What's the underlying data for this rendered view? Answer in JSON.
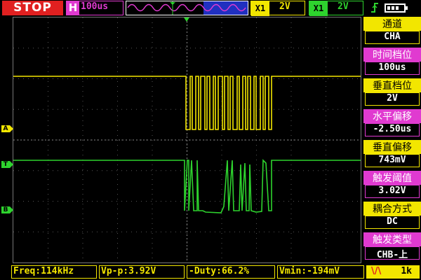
{
  "status": {
    "run_state": "STOP"
  },
  "timebase": {
    "label": "H",
    "value": "100us"
  },
  "channel_a": {
    "label": "X1",
    "volts_per_div": "2V",
    "color": "#f2e600"
  },
  "channel_b": {
    "label": "X1",
    "volts_per_div": "2V",
    "color": "#2ed32e"
  },
  "trigger_edge_icon": "rising-edge-icon",
  "battery": {
    "level": 0.75
  },
  "markers": {
    "ch_a": "A",
    "trigger": "T",
    "ch_b": "B"
  },
  "side_panel": [
    {
      "label": "通道",
      "value": "CHA",
      "color": "#f2e600"
    },
    {
      "label": "时间档位",
      "value": "100us",
      "color": "#e03ad0"
    },
    {
      "label": "垂直档位",
      "value": "2V",
      "color": "#f2e600"
    },
    {
      "label": "水平偏移",
      "value": "-2.50us",
      "color": "#e03ad0"
    },
    {
      "label": "垂直偏移",
      "value": "743mV",
      "color": "#f2e600"
    },
    {
      "label": "触发阈值",
      "value": "3.02V",
      "color": "#e03ad0"
    },
    {
      "label": "耦合方式",
      "value": "DC",
      "color": "#f2e600"
    },
    {
      "label": "触发类型",
      "value": "CHB-上",
      "color": "#e03ad0"
    }
  ],
  "measurements": {
    "freq": "Freq:114kHz",
    "vpp": "Vp-p:3.92V",
    "duty": "-Duty:66.2%",
    "vmin": "Vmin:-194mV"
  },
  "sound": {
    "icon": "speaker-wave-icon",
    "value": "1k"
  }
}
